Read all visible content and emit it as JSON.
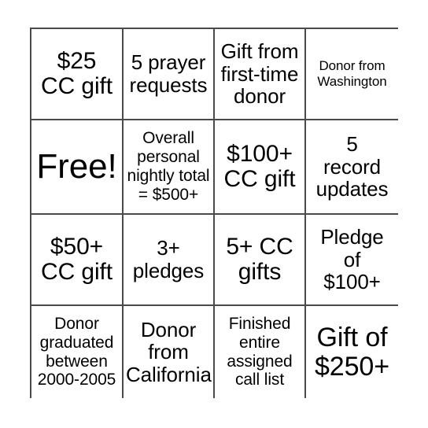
{
  "card": {
    "columns": 4,
    "rows": 4,
    "border_color": "#4a4a4a",
    "background": "#ffffff",
    "text_color": "#000000",
    "cells": [
      {
        "text": "$25\nCC gift",
        "size": "s-lg",
        "name": "bingo-cell-25-cc-gift"
      },
      {
        "text": "5 prayer\nrequests",
        "size": "s-md",
        "name": "bingo-cell-5-prayer-requests"
      },
      {
        "text": "Gift from\nfirst-time\ndonor",
        "size": "s-md",
        "name": "bingo-cell-gift-from-first-time-donor"
      },
      {
        "text": "Donor from\nWashington",
        "size": "s-xs",
        "name": "bingo-cell-donor-from-washington"
      },
      {
        "text": "Free!",
        "size": "s-xxl",
        "name": "bingo-cell-free"
      },
      {
        "text": "Overall\npersonal\nnightly total\n= $500+",
        "size": "s-sm",
        "name": "bingo-cell-overall-personal-nightly-total"
      },
      {
        "text": "$100+\nCC gift",
        "size": "s-lg",
        "name": "bingo-cell-100-cc-gift"
      },
      {
        "text": "5\nrecord\nupdates",
        "size": "s-md",
        "name": "bingo-cell-5-record-updates"
      },
      {
        "text": "$50+\nCC gift",
        "size": "s-lg",
        "name": "bingo-cell-50-cc-gift"
      },
      {
        "text": "3+\npledges",
        "size": "s-md",
        "name": "bingo-cell-3-pledges"
      },
      {
        "text": "5+ CC\ngifts",
        "size": "s-lg",
        "name": "bingo-cell-5-cc-gifts"
      },
      {
        "text": "Pledge\nof\n$100+",
        "size": "s-md",
        "name": "bingo-cell-pledge-of-100"
      },
      {
        "text": "Donor\ngraduated\nbetween\n2000-2005",
        "size": "s-sm",
        "name": "bingo-cell-donor-graduated-2000-2005"
      },
      {
        "text": "Donor\nfrom\nCalifornia",
        "size": "s-md",
        "name": "bingo-cell-donor-from-california"
      },
      {
        "text": "Finished\nentire\nassigned\ncall list",
        "size": "s-sm",
        "name": "bingo-cell-finished-entire-assigned-call-list"
      },
      {
        "text": "Gift of\n$250+",
        "size": "s-xl",
        "name": "bingo-cell-gift-of-250"
      }
    ]
  }
}
